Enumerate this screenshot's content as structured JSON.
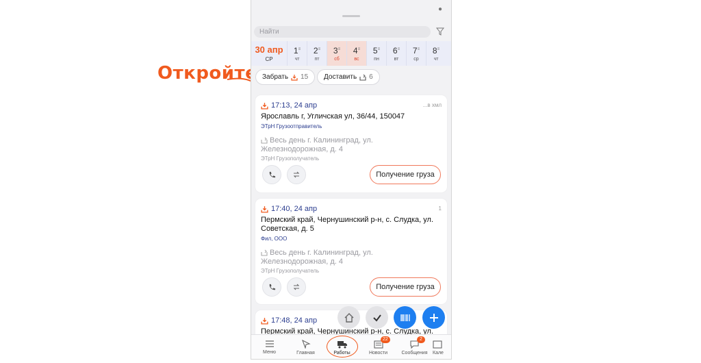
{
  "annotation": {
    "label": "Откройте"
  },
  "search": {
    "placeholder": "Найти"
  },
  "date_strip": {
    "today": {
      "date": "30 апр",
      "weekday": "СР"
    },
    "days": [
      {
        "num": "1",
        "wd": "чт",
        "weekend": false
      },
      {
        "num": "2",
        "wd": "пт",
        "weekend": false
      },
      {
        "num": "3",
        "wd": "сб",
        "weekend": true
      },
      {
        "num": "4",
        "wd": "вс",
        "weekend": true
      },
      {
        "num": "5",
        "wd": "пн",
        "weekend": false
      },
      {
        "num": "6",
        "wd": "вт",
        "weekend": false
      },
      {
        "num": "7",
        "wd": "ср",
        "weekend": false
      },
      {
        "num": "8",
        "wd": "чт",
        "weekend": false
      }
    ]
  },
  "chips": {
    "pickup": {
      "label": "Забрать",
      "count": "15"
    },
    "deliver": {
      "label": "Доставить",
      "count": "6"
    }
  },
  "cards": [
    {
      "time": "17:13, 24 апр",
      "corner": "...в хмл",
      "address": "Ярославль г, Угличская ул, 36/44, 150047",
      "org": "ЭТрН Грузоотправитель",
      "delivery": "Весь день г. Калининград, ул. Железнодорожная, д. 4",
      "delivery_org": "ЭТрН Грузополучатель",
      "action": "Получение груза"
    },
    {
      "time": "17:40, 24 апр",
      "corner": "1",
      "address": "Пермский край, Чернушинский р-н, с. Слудка, ул. Советская, д. 5",
      "org": "Фил, ООО",
      "delivery": "Весь день г. Калининград, ул. Железнодорожная, д. 4",
      "delivery_org": "ЭТрН Грузополучатель",
      "action": "Получение груза"
    },
    {
      "time": "17:48, 24 апр",
      "address": "Пермский край, Чернушинский р-н, с. Слудка, ул."
    }
  ],
  "nav": {
    "items": [
      {
        "label": "Меню",
        "icon": "menu-icon"
      },
      {
        "label": "Главная",
        "icon": "home-icon"
      },
      {
        "label": "Работы",
        "icon": "truck-icon"
      },
      {
        "label": "Новости",
        "icon": "news-icon",
        "badge": "22"
      },
      {
        "label": "Сообщения",
        "icon": "chat-icon",
        "badge": "2"
      },
      {
        "label": "Кале",
        "icon": "calendar-icon"
      }
    ]
  },
  "colors": {
    "accent": "#f05a1e",
    "primary": "#1e7ff0",
    "link": "#2b3d8f"
  }
}
